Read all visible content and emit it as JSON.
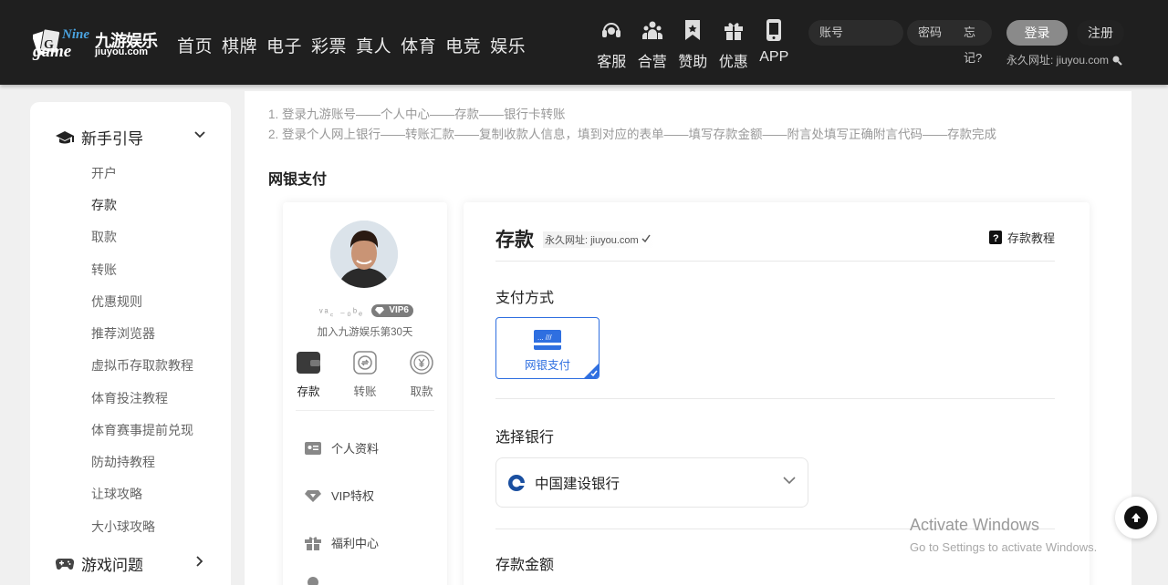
{
  "brand": {
    "en_top": "Nine",
    "en_bottom": "game",
    "cn": "九游娱乐",
    "domain": "jiuyou.com"
  },
  "nav": [
    "首页",
    "棋牌",
    "电子",
    "彩票",
    "真人",
    "体育",
    "电竞",
    "娱乐"
  ],
  "quick_links": [
    {
      "label": "客服",
      "icon": "headset-icon"
    },
    {
      "label": "合营",
      "icon": "people-icon"
    },
    {
      "label": "赞助",
      "icon": "bookmark-icon"
    },
    {
      "label": "优惠",
      "icon": "gift-icon"
    },
    {
      "label": "APP",
      "icon": "phone-icon"
    }
  ],
  "login": {
    "account_placeholder": "账号",
    "password_placeholder": "密码",
    "forgot": "忘记?",
    "login_btn": "登录",
    "register_btn": "注册"
  },
  "permanent_url": "永久网址: jiuyou.com",
  "sidebar": {
    "guide_title": "新手引导",
    "items": [
      "开户",
      "存款",
      "取款",
      "转账",
      "优惠规则",
      "推荐浏览器",
      "虚拟币存取款教程",
      "体育投注教程",
      "体育赛事提前兑现",
      "防劫持教程",
      "让球攻略",
      "大小球攻略"
    ],
    "active_index": 1,
    "games_title": "游戏问题"
  },
  "steps": [
    "1. 登录九游账号——个人中心——存款——银行卡转账",
    "2. 登录个人网上银行——转账汇款——复制收款人信息，填到对应的表单——填写存款金额——附言处填写正确附言代码——存款完成"
  ],
  "netbank_heading": "网银支付",
  "profile": {
    "username": "ᵛᵃ꜀ ₋₀ᵇₑ",
    "vip": "VIP6",
    "join_text": "加入九游娱乐第30天",
    "actions": [
      {
        "label": "存款",
        "icon": "wallet-icon"
      },
      {
        "label": "转账",
        "icon": "transfer-icon"
      },
      {
        "label": "取款",
        "icon": "yen-icon"
      }
    ],
    "menu": [
      {
        "label": "个人资料",
        "icon": "id-card-icon"
      },
      {
        "label": "VIP特权",
        "icon": "diamond-icon"
      },
      {
        "label": "福利中心",
        "icon": "gift-icon"
      }
    ]
  },
  "deposit": {
    "title": "存款",
    "perm_url": "永久网址: jiuyou.com",
    "tutorial": "存款教程",
    "payment_method_label": "支付方式",
    "payment_option": "网银支付",
    "bank_label": "选择银行",
    "selected_bank": "中国建设银行",
    "amount_label": "存款金额"
  },
  "windows_notice": {
    "title": "Activate Windows",
    "subtitle": "Go to Settings to activate Windows."
  },
  "colors": {
    "header_bg": "#1f1f1f",
    "accent_blue": "#2f6fe0",
    "page_bg": "#f0f0f0"
  }
}
